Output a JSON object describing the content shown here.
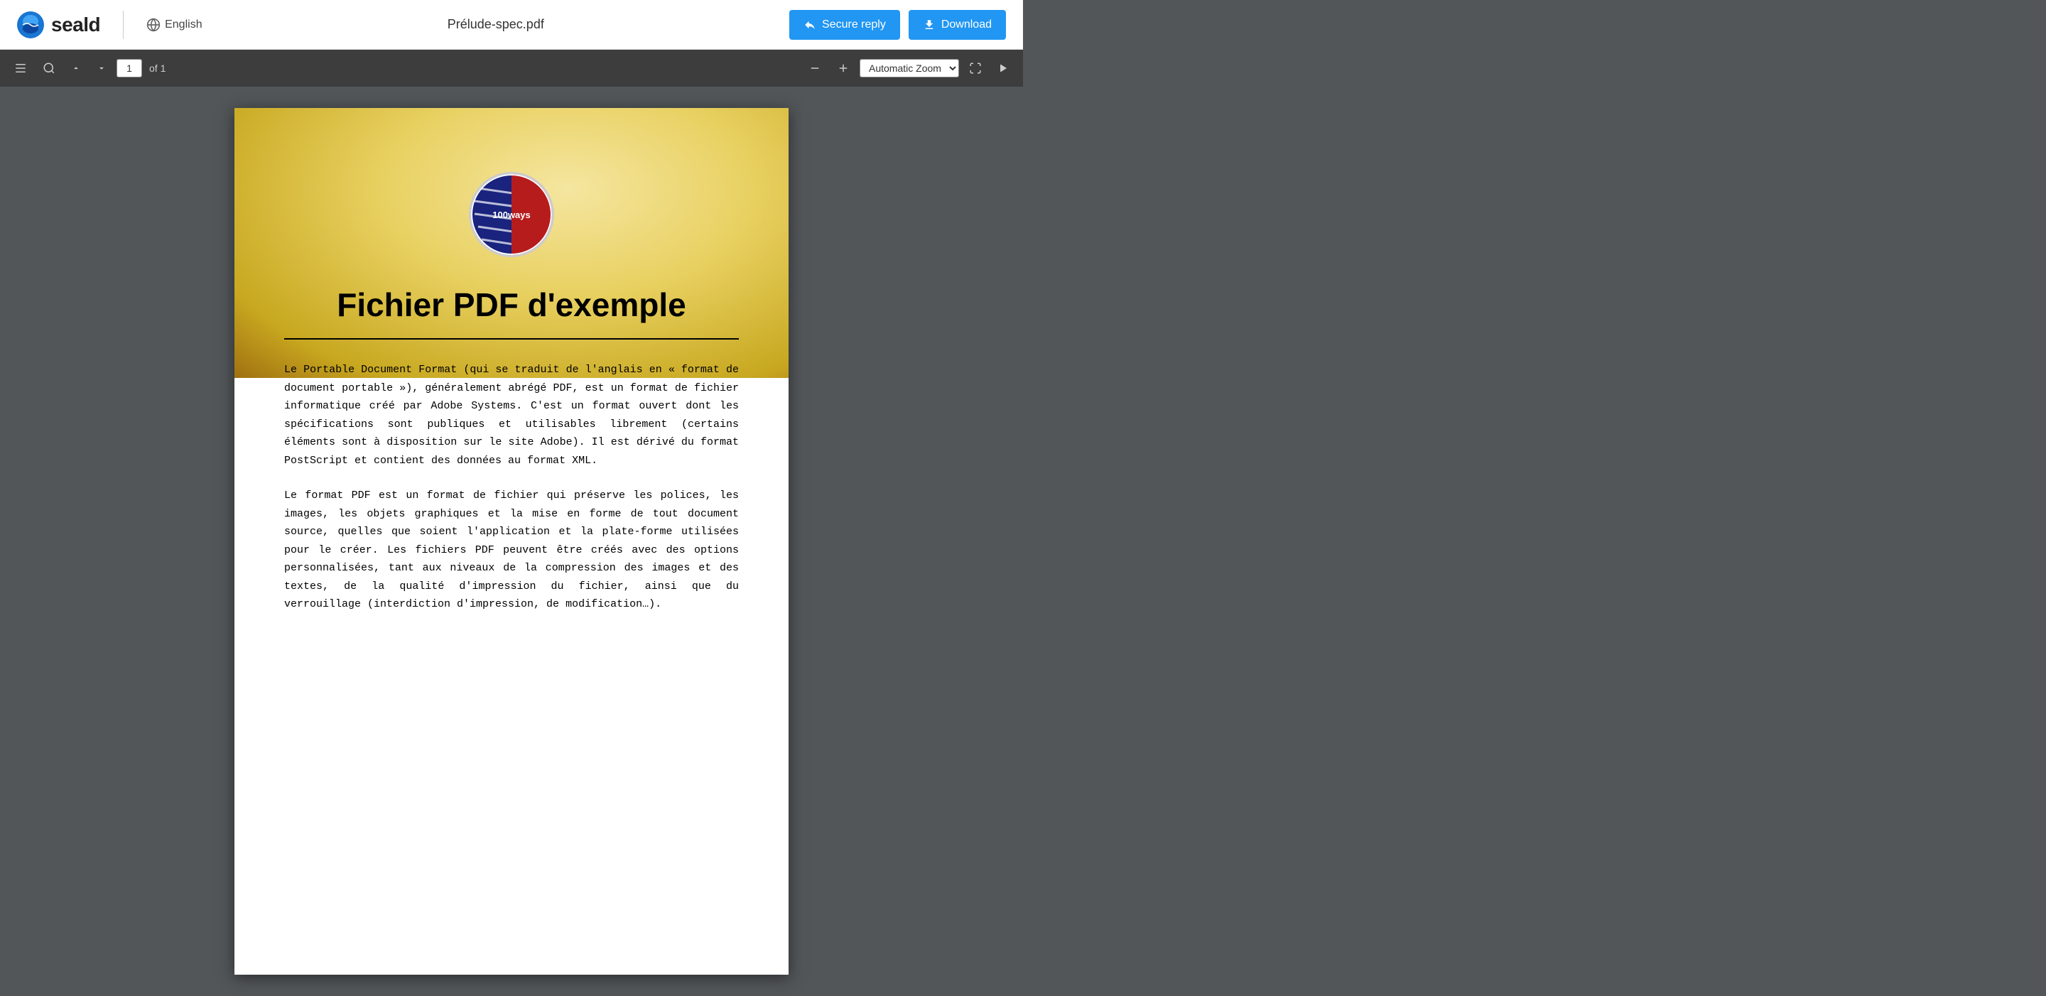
{
  "header": {
    "logo_text": "seald",
    "language_label": "English",
    "file_title": "Prélude-spec.pdf",
    "secure_reply_label": "Secure reply",
    "download_label": "Download"
  },
  "pdf_toolbar": {
    "sidebar_toggle_icon": "☰",
    "search_icon": "🔍",
    "prev_icon": "▲",
    "next_icon": "▼",
    "page_current": "1",
    "page_total": "of 1",
    "zoom_minus": "−",
    "zoom_plus": "+",
    "zoom_label": "Automatic Zoom",
    "fullscreen_icon": "⛶",
    "more_icon": "»"
  },
  "pdf_content": {
    "logo_text": "100WAYS",
    "title": "Fichier PDF d'exemple",
    "paragraph1": "Le Portable Document Format (qui se traduit de l'anglais en « format de document portable »), généralement abrégé PDF, est un format de fichier informatique créé par Adobe Systems. C'est un format ouvert dont les spécifications sont publiques et utilisables librement (certains éléments sont à disposition sur le site Adobe). Il est dérivé du format PostScript et contient des données au format XML.",
    "paragraph2": "Le format PDF est un format de fichier qui préserve les polices, les images, les objets graphiques et la mise en forme de tout document source, quelles que soient l'application et la plate-forme utilisées pour le créer. Les fichiers PDF peuvent être créés avec des options personnalisées, tant aux niveaux de la compression des images et des textes, de la qualité d'impression du fichier, ainsi que du verrouillage (interdiction d'impression, de modification…)."
  }
}
